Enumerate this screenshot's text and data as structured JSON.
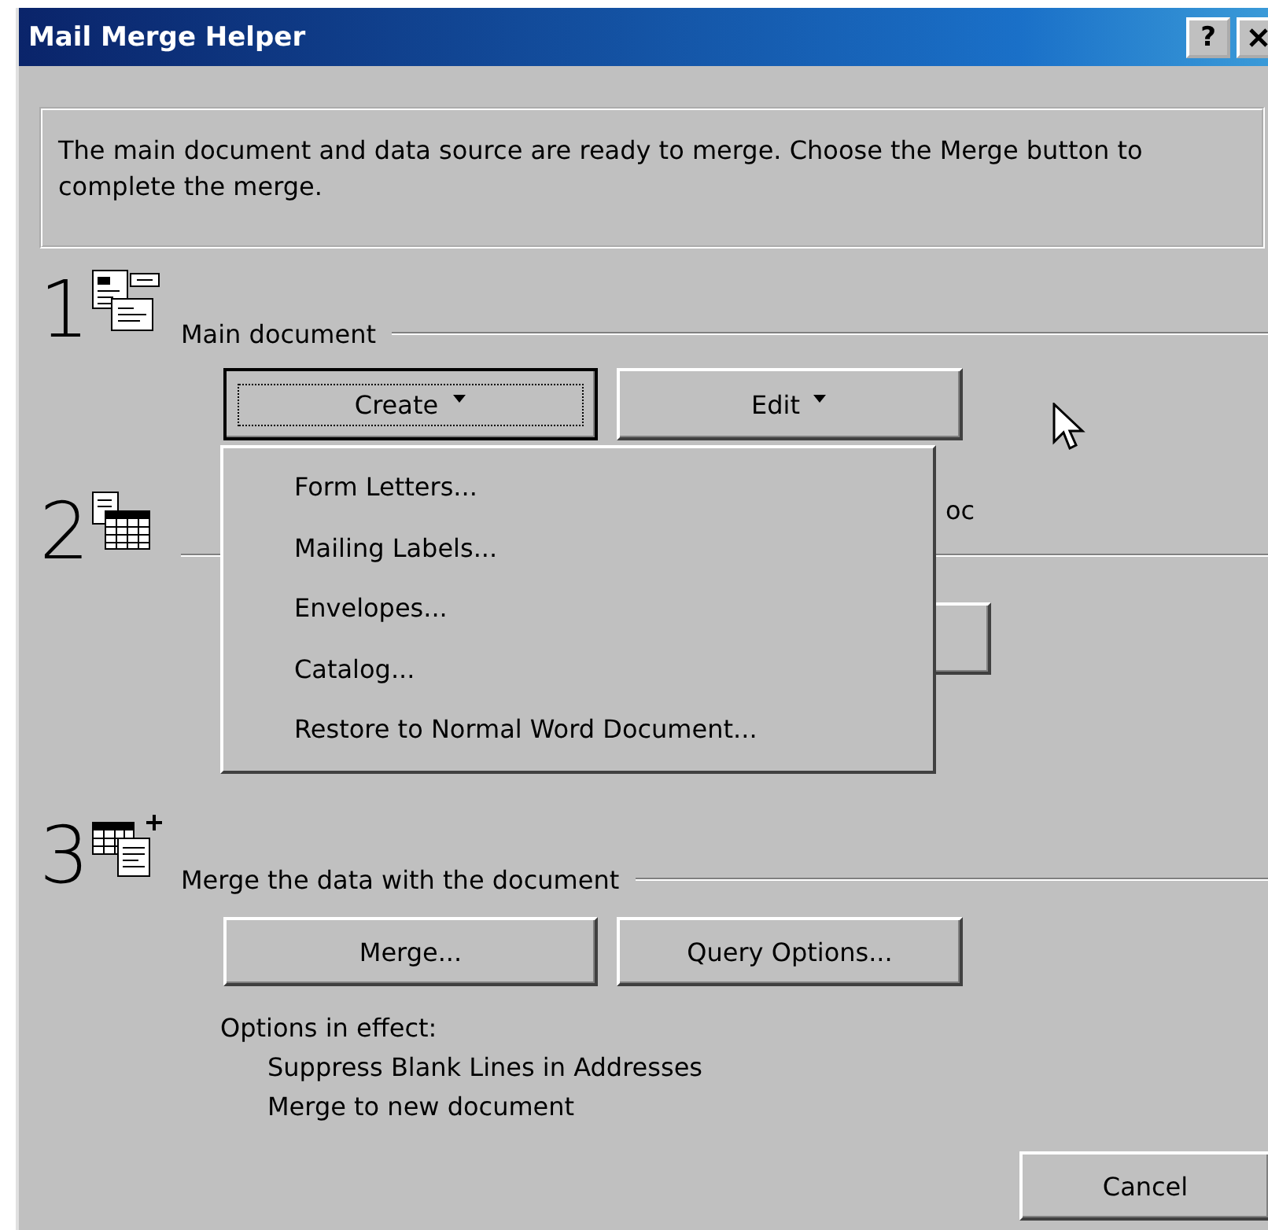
{
  "window": {
    "title": "Mail Merge Helper",
    "help_button": "?"
  },
  "instructions": "The main document and data source are ready to merge. Choose the Merge button to complete the merge.",
  "steps": [
    {
      "number": "1",
      "kind": "main",
      "label": "Main document",
      "buttons": [
        {
          "label": "Create",
          "dropdown": true,
          "focused": true
        },
        {
          "label": "Edit",
          "dropdown": true,
          "focused": false
        }
      ]
    },
    {
      "number": "2",
      "kind": "data",
      "fragment": "oc"
    },
    {
      "number": "3",
      "kind": "merge",
      "label": "Merge the data with the document",
      "buttons": [
        {
          "label": "Merge...",
          "dropdown": false,
          "focused": false
        },
        {
          "label": "Query Options...",
          "dropdown": false,
          "focused": false
        }
      ],
      "options_heading": "Options in effect:",
      "options": [
        "Suppress Blank Lines in Addresses",
        "Merge to new document"
      ]
    }
  ],
  "menu": {
    "items": [
      "Form Letters...",
      "Mailing Labels...",
      "Envelopes...",
      "Catalog...",
      "Restore to Normal Word Document..."
    ]
  },
  "buttons": [
    "Cancel"
  ]
}
